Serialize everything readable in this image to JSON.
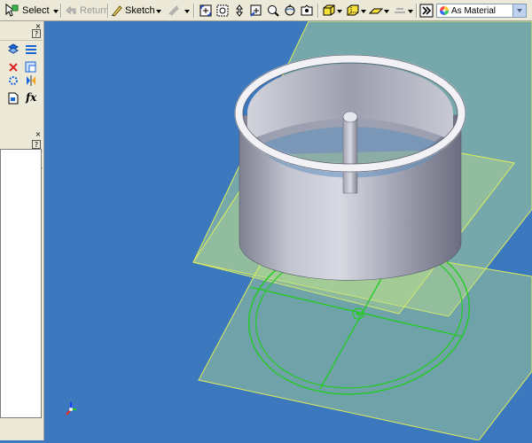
{
  "toolbar": {
    "select_label": "Select",
    "return_label": "Return",
    "sketch_label": "Sketch",
    "appearance_value": "As Material"
  },
  "side_panel": {
    "help_glyph": "?",
    "close_glyph": "×",
    "fx_label": "fx"
  },
  "colors": {
    "viewport_bg": "#3b78bd",
    "work_plane_fill": "#bfe38a",
    "work_plane_edge": "#e0ef5a",
    "sketch_green": "#22cc22",
    "part_metal": "#b4b6c4"
  }
}
